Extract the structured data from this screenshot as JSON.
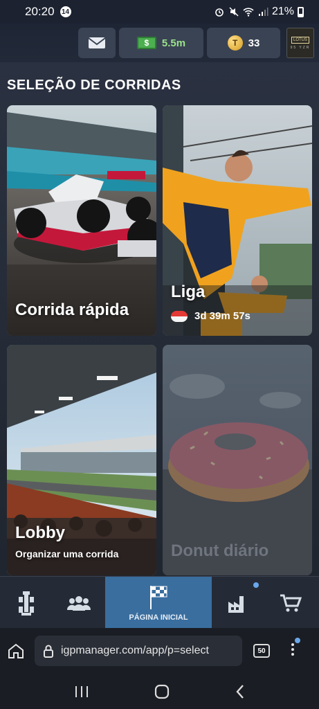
{
  "status_bar": {
    "time": "20:20",
    "notification_count": "14",
    "battery": "21%"
  },
  "top_bar": {
    "cash": "5.5m",
    "tokens": "33",
    "team_logo_text": "LOTUS",
    "team_logo_years": "95  YZR"
  },
  "main": {
    "section_title": "SELEÇÃO DE CORRIDAS",
    "cards": {
      "quick_race": {
        "label": "Corrida rápida"
      },
      "league": {
        "label": "Liga",
        "timer": "3d 39m 57s"
      },
      "lobby": {
        "label": "Lobby",
        "subtitle": "Organizar uma corrida"
      },
      "daily_donut": {
        "label": "Donut diário"
      }
    }
  },
  "bottom_nav": {
    "active_label": "PÁGINA INICIAL"
  },
  "browser": {
    "url": "igpmanager.com/app/p=select",
    "tab_count": "50"
  },
  "colors": {
    "accent_active_tab": "#3a6e9e",
    "cash_green": "#9be38a"
  }
}
